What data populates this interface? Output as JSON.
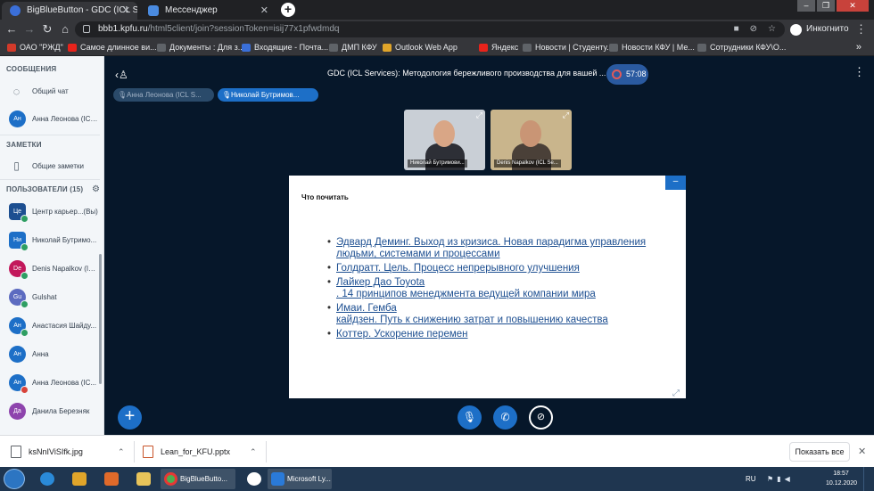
{
  "browser": {
    "tabs": [
      {
        "title": "BigBlueButton - GDC (ICL Se"
      },
      {
        "title": "Мессенджер"
      }
    ],
    "url_host": "bbb1.kpfu.ru",
    "url_path": "/html5client/join?sessionToken=isij77x1pfwdmdq",
    "profile_label": "Инкогнито",
    "bookmarks": [
      {
        "label": "ОАО \"РЖД\"",
        "color": "#d23a2a"
      },
      {
        "label": "Самое длинное ви...",
        "color": "#e8231b"
      },
      {
        "label": "Документы : Для з...",
        "color": "#5f6368"
      },
      {
        "label": "Входящие - Почта...",
        "color": "#3a6fd8"
      },
      {
        "label": "ДМП КФУ",
        "color": "#5f6368"
      },
      {
        "label": "Outlook Web App",
        "color": "#e0a52a"
      },
      {
        "label": "Яндекс",
        "color": "#e8231b"
      },
      {
        "label": "Новости | Студенту...",
        "color": "#5f6368"
      },
      {
        "label": "Новости КФУ | Ме...",
        "color": "#5f6368"
      },
      {
        "label": "Сотрудники КФУ\\О...",
        "color": "#5f6368"
      }
    ],
    "bookmarks_more": "»"
  },
  "sidebar": {
    "messages_heading": "СООБЩЕНИЯ",
    "public_chat": "Общий чат",
    "private_chat": {
      "initials": "Ан",
      "name": "Анна Леонова (ICL ..."
    },
    "notes_heading": "ЗАМЕТКИ",
    "shared_notes": "Общие заметки",
    "users_heading": "ПОЛЬЗОВАТЕЛИ (15)",
    "users": [
      {
        "initials": "Це",
        "name": "Центр карьер...(Вы)",
        "color": "#1d4f91",
        "badge": "#2e9e62",
        "square": true
      },
      {
        "initials": "Ни",
        "name": "Николай Бутримо...",
        "color": "#1d6fc7",
        "badge": "#2e9e62",
        "square": true
      },
      {
        "initials": "De",
        "name": "Denis Napalkov (ICL ...",
        "color": "#c2185b",
        "badge": "#2e9e62",
        "square": false
      },
      {
        "initials": "Gu",
        "name": "Gulshat",
        "color": "#5c6bc0",
        "badge": "#2e9e62",
        "square": false
      },
      {
        "initials": "Ан",
        "name": "Анастасия Шайду...",
        "color": "#1d6fc7",
        "badge": "#2e9e62",
        "square": false
      },
      {
        "initials": "Ан",
        "name": "Анна",
        "color": "#1d6fc7",
        "badge": "",
        "square": false
      },
      {
        "initials": "Ан",
        "name": "Анна Леонова (IC...",
        "color": "#1d6fc7",
        "badge": "#d8433a",
        "square": false
      },
      {
        "initials": "Да",
        "name": "Данила Березняк",
        "color": "#8e44ad",
        "badge": "",
        "square": false
      }
    ]
  },
  "meeting": {
    "title_prefix": "GDC (ICL Services): ",
    "title": "Методология бережливого производства для вашей ...",
    "timer": "57:08",
    "talkers": [
      {
        "name": "Анна Леонова (ICL S...",
        "active": false
      },
      {
        "name": "Николай Бутримов...",
        "active": true
      }
    ],
    "videos": [
      {
        "name": "Николай Бутримови...",
        "bg": "#c9cfd6",
        "face": "#d9a686",
        "shirt": "#2d2f36"
      },
      {
        "name": "Denis Napalkov (ICL Se...",
        "bg": "#c9b58c",
        "face": "#c99575",
        "shirt": "#4a4038"
      }
    ],
    "slide": {
      "title": "Что почитать",
      "items": [
        "Эдвард Деминг. Выход из кризиса. Новая парадигма управления людьми, системами и процессами",
        "Голдратт. Цель. Процесс непрерывного улучшения",
        "Лайкер Дао Toyota\n. 14 принципов менеджмента ведущей компании мира",
        "Имаи. Гемба\n кайдзен. Путь к снижению затрат и повышению качества",
        "Коттер. Ускорение перемен"
      ]
    }
  },
  "downloads": {
    "files": [
      {
        "name": "ksNnIViSIfk.jpg"
      },
      {
        "name": "Lean_for_KFU.pptx"
      }
    ],
    "show_all": "Показать все"
  },
  "taskbar": {
    "app_window_label": "BigBlueButto...",
    "app_window2_label": "Microsoft Ly...",
    "lang": "RU",
    "time": "18:57",
    "date": "10.12.2020"
  },
  "colors": {
    "meeting_bg": "#06172a",
    "accent": "#1d6fc7",
    "sidebar_bg": "#f3f6f9",
    "link": "#1d4f91"
  }
}
